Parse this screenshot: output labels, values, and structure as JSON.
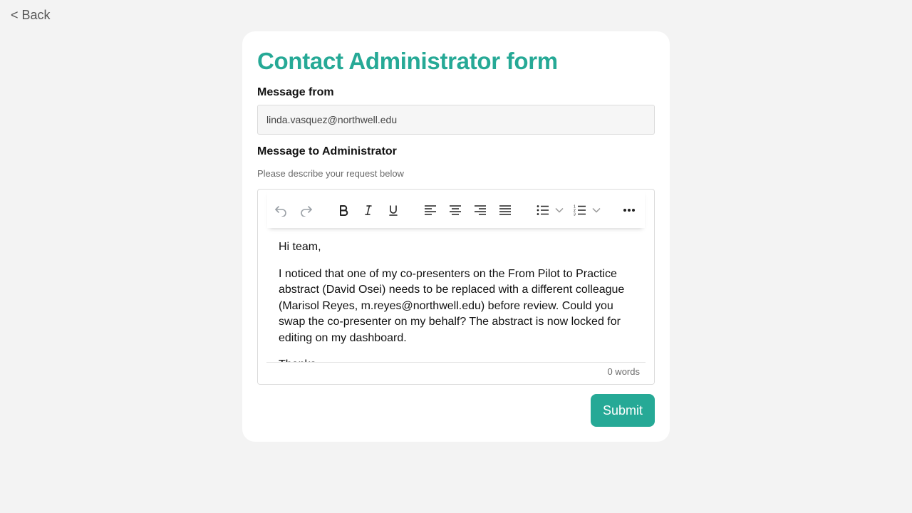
{
  "nav": {
    "back_label": "< Back"
  },
  "form": {
    "title": "Contact Administrator form",
    "from_label": "Message from",
    "from_value": "linda.vasquez@northwell.edu",
    "to_label": "Message to Administrator",
    "hint": "Please describe your request below",
    "submit_label": "Submit"
  },
  "editor": {
    "toolbar": [
      "undo-icon",
      "redo-icon",
      "bold-icon",
      "italic-icon",
      "underline-icon",
      "align-left-icon",
      "align-center-icon",
      "align-right-icon",
      "align-justify-icon",
      "bullet-list-icon",
      "numbered-list-icon",
      "more-icon"
    ],
    "paragraphs": [
      "Hi team,",
      "I noticed that one of my co-presenters on the From Pilot to Practice abstract (David Osei) needs to be replaced with a different colleague (Marisol Reyes, m.reyes@northwell.edu) before review. Could you swap the co-presenter on my behalf? The abstract is now locked for editing on my dashboard.",
      "Thanks,"
    ],
    "word_count": "0 words"
  },
  "colors": {
    "accent": "#26a996",
    "background": "#f3f3f3"
  }
}
